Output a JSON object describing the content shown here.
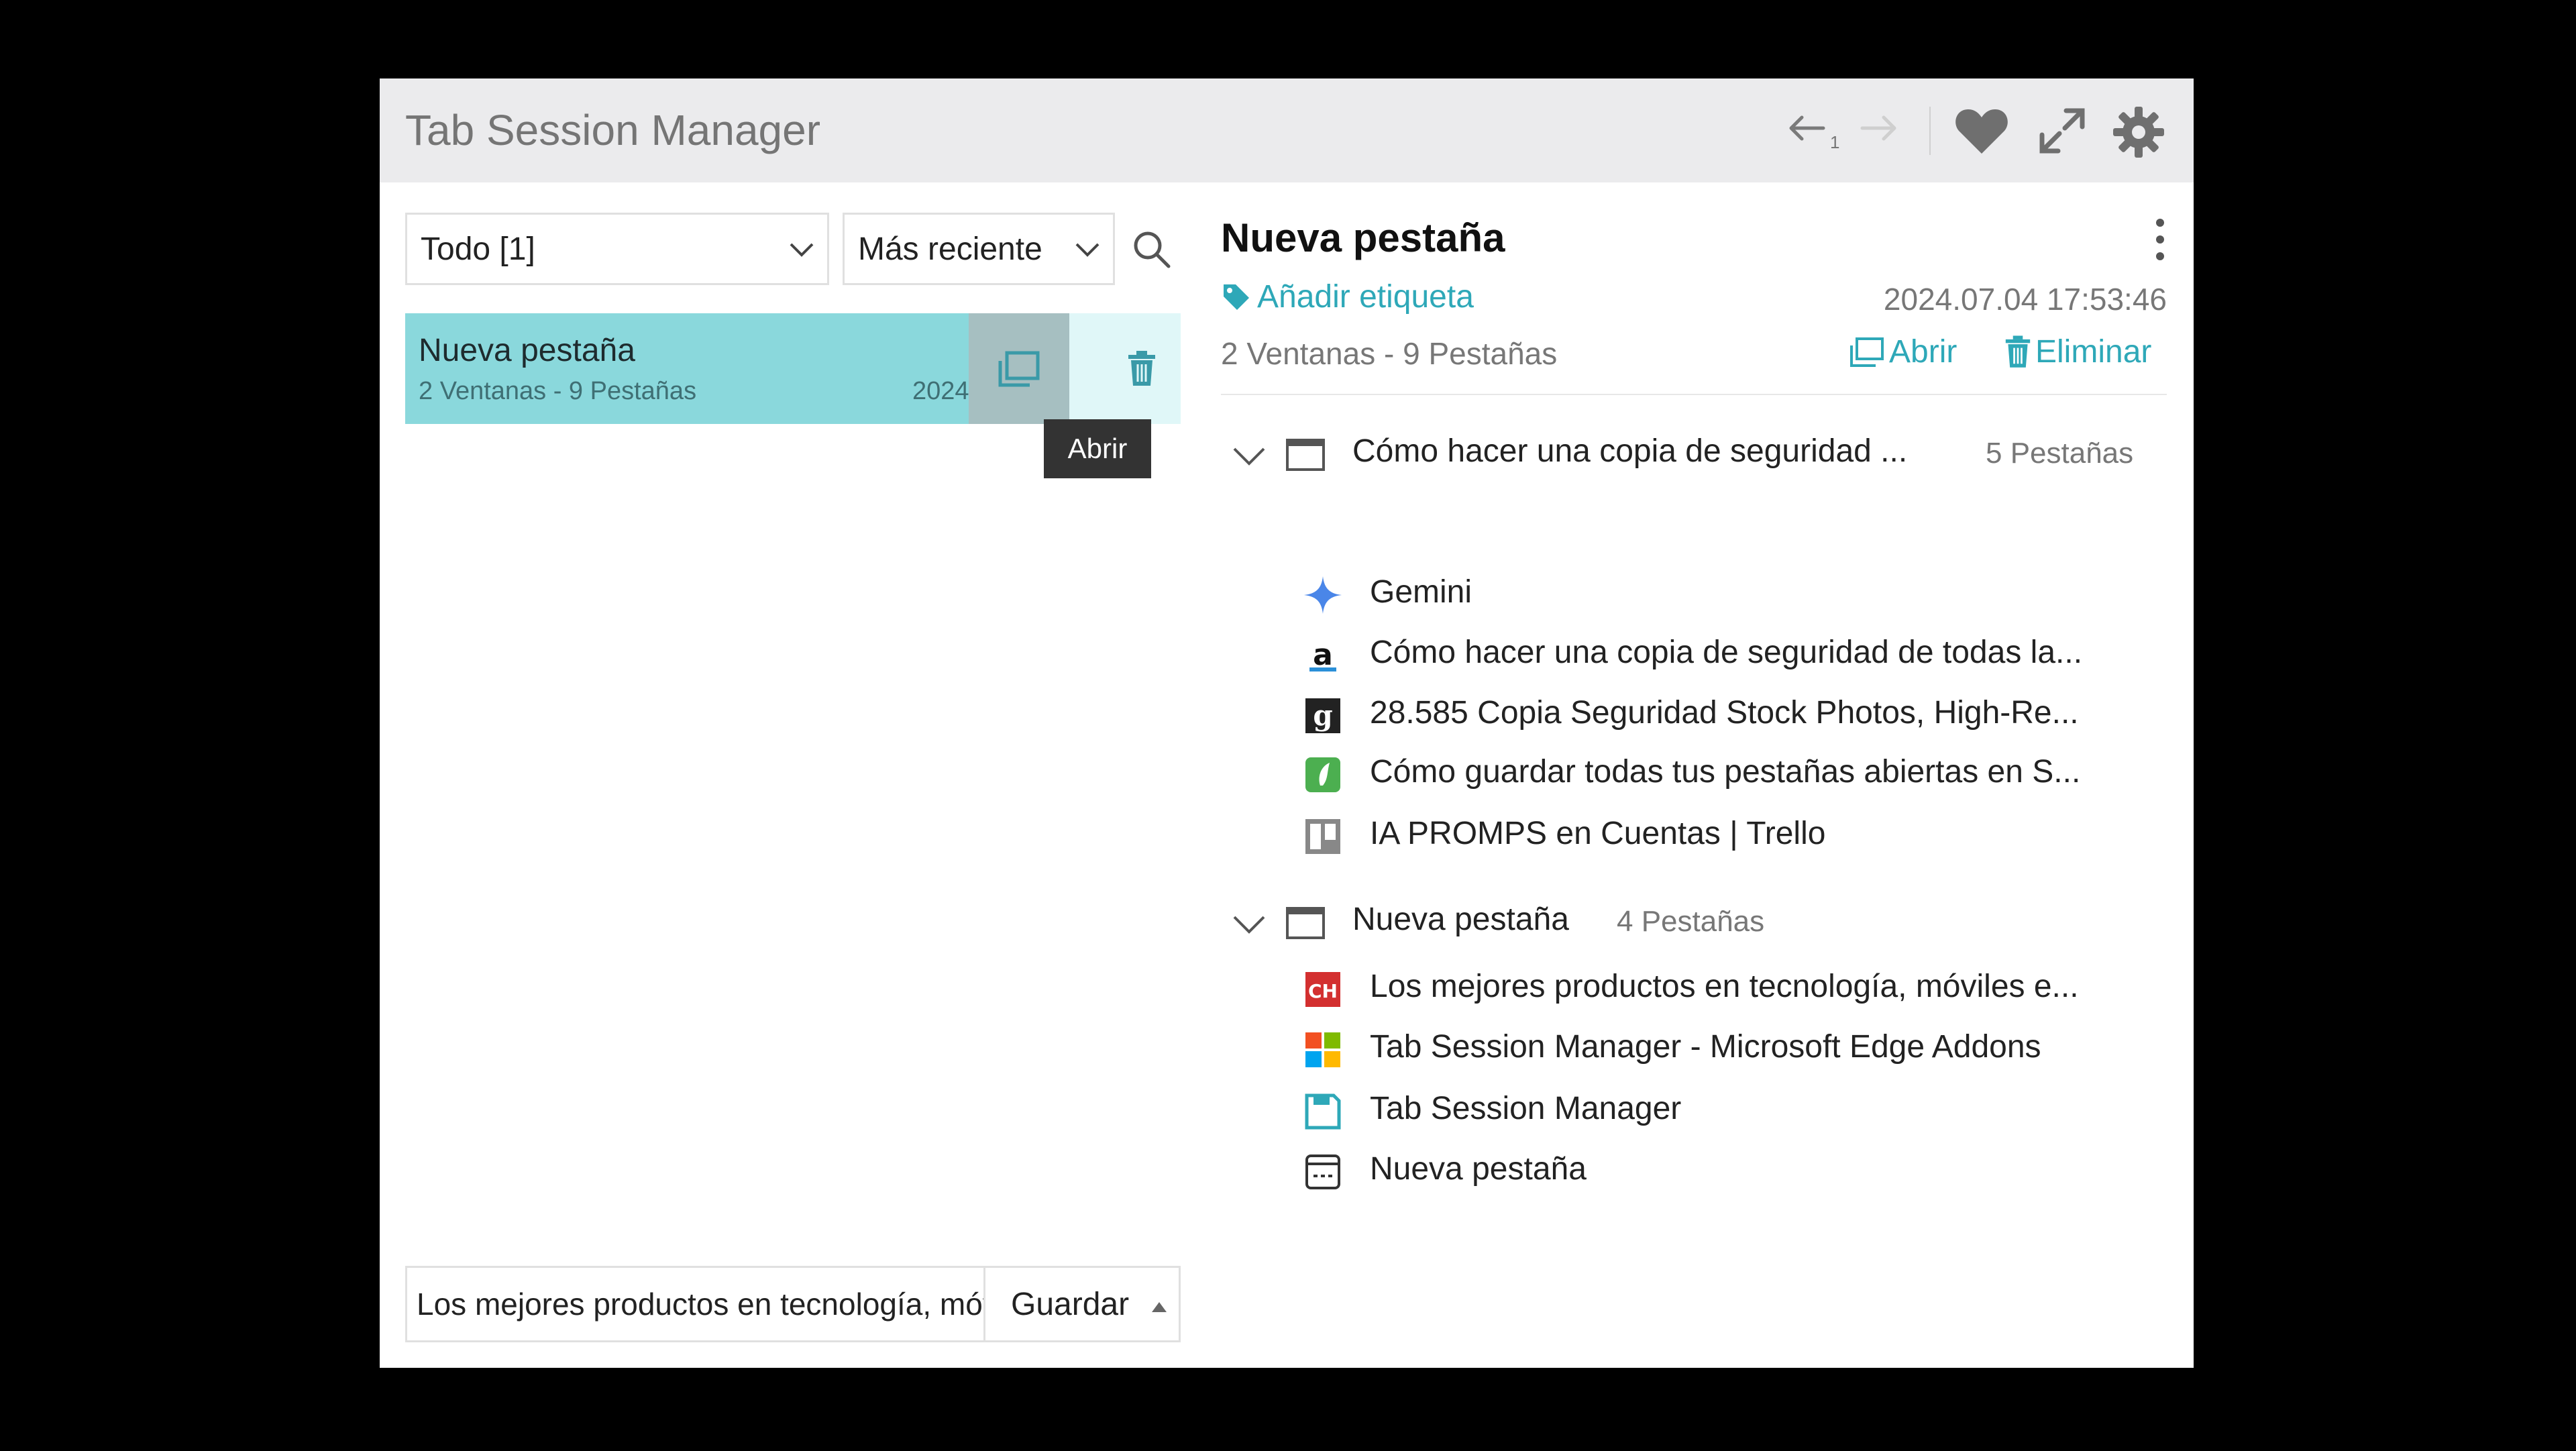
{
  "app": {
    "title": "Tab Session Manager",
    "undo_count": "1"
  },
  "header_icons": [
    "undo-icon",
    "redo-icon",
    "heart-icon",
    "expand-icon",
    "gear-icon"
  ],
  "filter": {
    "selected": "Todo [1]"
  },
  "sort": {
    "selected": "Más reciente"
  },
  "session_list": [
    {
      "name": "Nueva pestaña",
      "sub": "2 Ventanas - 9 Pestañas",
      "date": "2024"
    }
  ],
  "tooltip": "Abrir",
  "save": {
    "input_value": "Los mejores productos en tecnología, móviles e…",
    "button_label": "Guardar"
  },
  "detail": {
    "title": "Nueva pestaña",
    "add_tag": "Añadir etiqueta",
    "date": "2024.07.04 17:53:46",
    "counts": "2 Ventanas - 9 Pestañas",
    "open_label": "Abrir",
    "delete_label": "Eliminar",
    "windows": [
      {
        "title": "Cómo hacer una copia de seguridad ...",
        "count": "5 Pestañas",
        "tabs": [
          {
            "title": "Gemini",
            "icon": "gemini-icon"
          },
          {
            "title": "Cómo hacer una copia de seguridad de todas la...",
            "icon": "a-site-icon"
          },
          {
            "title": "28.585 Copia Seguridad Stock Photos, High-Re...",
            "icon": "g-site-icon"
          },
          {
            "title": "Cómo guardar todas tus pestañas abiertas en S...",
            "icon": "green-site-icon"
          },
          {
            "title": "IA PROMPS en Cuentas | Trello",
            "icon": "trello-icon"
          }
        ]
      },
      {
        "title": "Nueva pestaña",
        "count": "4 Pestañas",
        "tabs": [
          {
            "title": "Los mejores productos en tecnología, móviles e...",
            "icon": "ch-site-icon"
          },
          {
            "title": "Tab Session Manager - Microsoft Edge Addons",
            "icon": "microsoft-icon"
          },
          {
            "title": "Tab Session Manager",
            "icon": "floppy-icon"
          },
          {
            "title": "Nueva pestaña",
            "icon": "newtab-icon"
          }
        ]
      }
    ]
  },
  "colors": {
    "accent": "#2ea8b8",
    "selected_row": "#8ad8dc",
    "header_bg": "#ebebed"
  }
}
